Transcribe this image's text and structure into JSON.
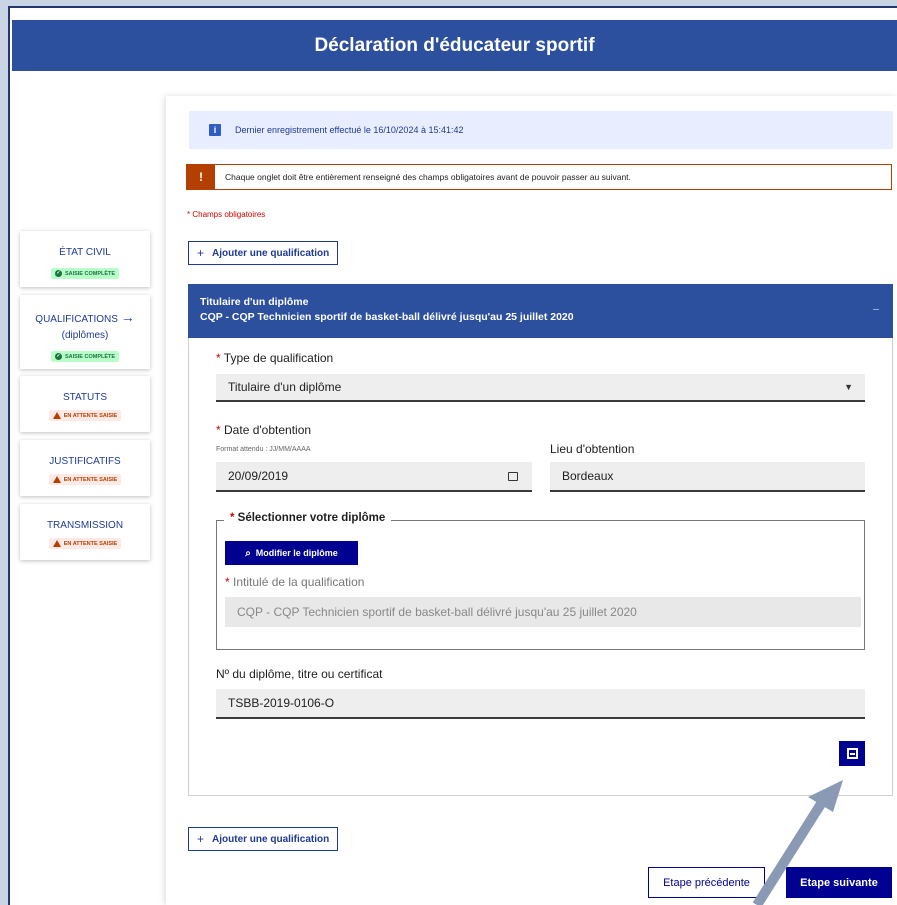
{
  "header": {
    "title": "Déclaration d'éducateur sportif"
  },
  "sidebar": {
    "items": [
      {
        "label": "ÉTAT CIVIL",
        "badge": "SAISIE COMPLÈTE",
        "status": "ok"
      },
      {
        "label": "QUALIFICATIONS",
        "sublabel": "(diplômes)",
        "badge": "SAISIE COMPLÈTE",
        "status": "ok",
        "active_arrow": "→"
      },
      {
        "label": "STATUTS",
        "badge": "EN ATTENTE SAISIE",
        "status": "wait"
      },
      {
        "label": "JUSTIFICATIFS",
        "badge": "EN ATTENTE SAISIE",
        "status": "wait"
      },
      {
        "label": "TRANSMISSION",
        "badge": "EN ATTENTE SAISIE",
        "status": "wait"
      }
    ]
  },
  "alerts": {
    "info_icon": "i",
    "info": "Dernier enregistrement effectué le 16/10/2024 à 15:41:42",
    "warning_icon": "!",
    "warning": "Chaque onglet doit être entièrement renseigné des champs obligatoires avant de pouvoir passer au suivant."
  },
  "required_note": "Champs obligatoires",
  "add_qualification": {
    "plus": "+",
    "label": "Ajouter une qualification"
  },
  "panel": {
    "title": "Titulaire d'un diplôme",
    "subtitle": "CQP - CQP Technicien sportif de basket-ball délivré jusqu'au 25 juillet 2020",
    "collapse": "–"
  },
  "form": {
    "type_label": "Type de qualification",
    "type_value": "Titulaire d'un diplôme",
    "date_label": "Date d'obtention",
    "date_hint": "Format attendu : JJ/MM/AAAA",
    "date_value": "20/09/2019",
    "place_label": "Lieu d'obtention",
    "place_value": "Bordeaux",
    "diploma_legend": "Sélectionner votre diplôme",
    "modify_button": "Modifier le diplôme",
    "intitule_label": "Intitulé de la qualification",
    "intitule_value": "CQP - CQP Technicien sportif de basket-ball délivré jusqu'au 25 juillet 2020",
    "number_label": "Nº du diplôme, titre ou certificat",
    "number_value": "TSBB-2019-0106-O"
  },
  "nav": {
    "prev": "Etape précédente",
    "next": "Etape suivante"
  },
  "colors": {
    "primary": "#000091",
    "header": "#2c4f9e",
    "warning": "#b34000",
    "success": "#18753c"
  }
}
